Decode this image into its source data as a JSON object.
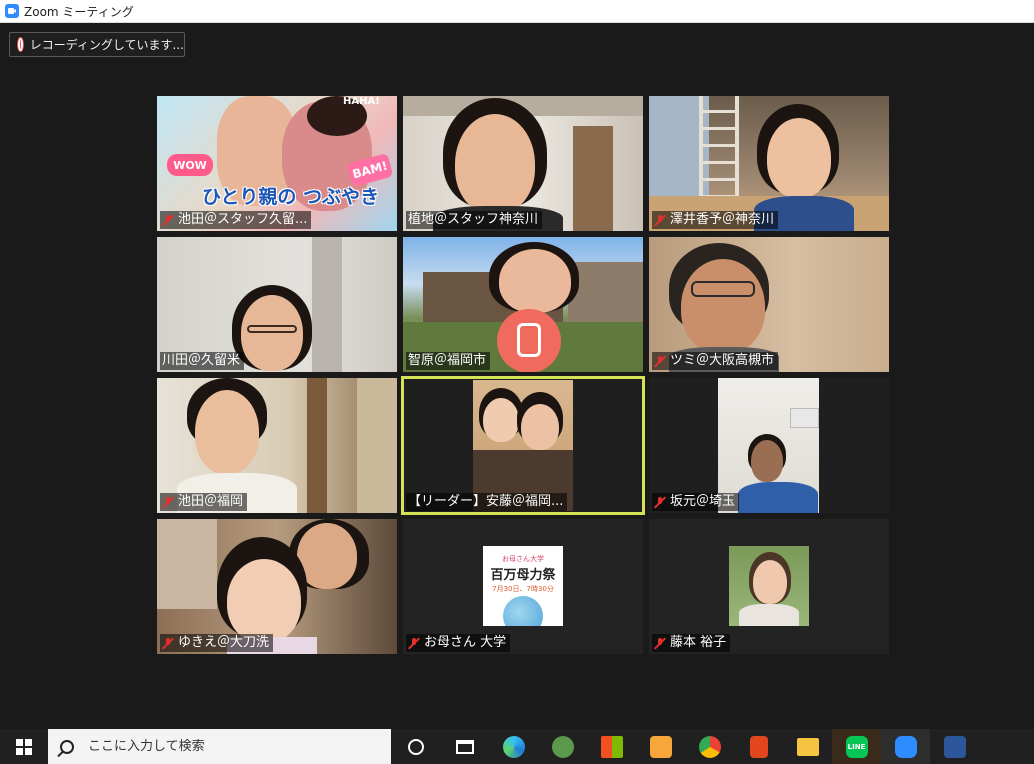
{
  "window": {
    "title": "Zoom ミーティング"
  },
  "recording": {
    "label": "レコーディングしています..."
  },
  "tiles": [
    {
      "name": "池田＠スタッフ久留...",
      "muted": true
    },
    {
      "name": "植地＠スタッフ神奈川",
      "muted": false
    },
    {
      "name": "澤井香予＠神奈川",
      "muted": true
    },
    {
      "name": "川田＠久留米",
      "muted": false
    },
    {
      "name": "智原＠福岡市",
      "muted": false
    },
    {
      "name": "ツミ＠大阪高槻市",
      "muted": true
    },
    {
      "name": "池田＠福岡",
      "muted": true
    },
    {
      "name": "【リーダー】安藤＠福岡...",
      "muted": false
    },
    {
      "name": "坂元＠埼玉",
      "muted": true
    },
    {
      "name": "ゆきえ＠大刀洗",
      "muted": true
    },
    {
      "name": "お母さん 大学",
      "muted": true
    },
    {
      "name": "藤本 裕子",
      "muted": true
    }
  ],
  "tile_texts": {
    "sticker_words": [
      "WOW",
      "HAHA!",
      "BAM!"
    ],
    "sticker_caption": "ひとり親の つぶやき",
    "poster_header": "お母さん大学",
    "poster_title": "百万母力祭",
    "poster_date": "7月30日、7時30分"
  },
  "taskbar": {
    "search_placeholder": "ここに入力して検索",
    "apps": [
      "cortana-icon",
      "task-view-icon",
      "edge-icon",
      "green-app-icon",
      "store-icon",
      "media-icon",
      "chrome-icon",
      "office-icon",
      "file-explorer-icon",
      "line-icon",
      "zoom-icon",
      "word-icon"
    ],
    "line_label": "LINE"
  },
  "colors": {
    "active_speaker": "#d4e255",
    "recording": "#e64a4a",
    "muted_mic": "#e2302d"
  }
}
